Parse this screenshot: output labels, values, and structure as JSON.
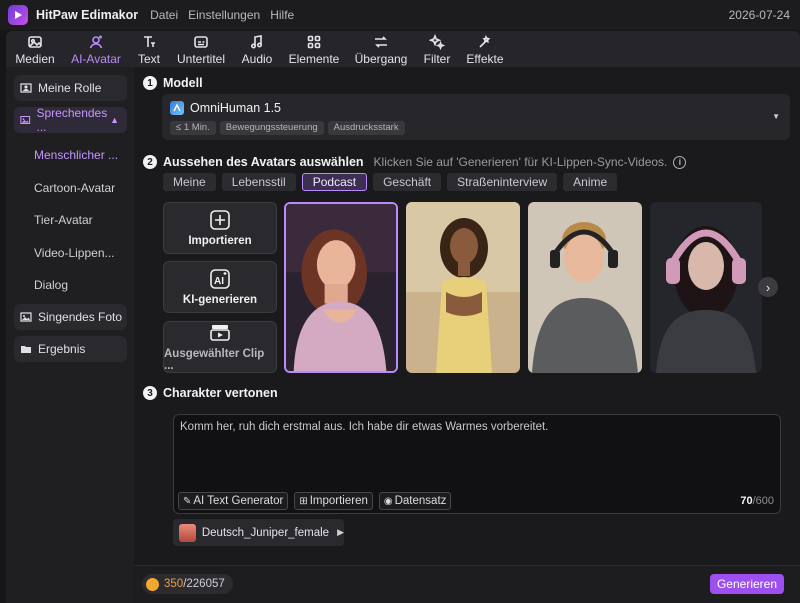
{
  "app": {
    "name": "HitPaw Edimakor",
    "menu": [
      "Datei",
      "Einstellungen",
      "Hilfe"
    ],
    "date": "2026-07-24",
    "accent": "#b98bff"
  },
  "toolbar": [
    {
      "label": "Medien",
      "icon": "media-icon",
      "active": false
    },
    {
      "label": "AI-Avatar",
      "icon": "avatar-icon",
      "active": true
    },
    {
      "label": "Text",
      "icon": "text-icon",
      "active": false
    },
    {
      "label": "Untertitel",
      "icon": "subtitle-icon",
      "active": false
    },
    {
      "label": "Audio",
      "icon": "audio-icon",
      "active": false
    },
    {
      "label": "Elemente",
      "icon": "elements-icon",
      "active": false
    },
    {
      "label": "Übergang",
      "icon": "transition-icon",
      "active": false
    },
    {
      "label": "Filter",
      "icon": "filter-icon",
      "active": false
    },
    {
      "label": "Effekte",
      "icon": "effects-icon",
      "active": false
    }
  ],
  "sidebar": {
    "my_role": "Meine Rolle",
    "speaking": "Sprechendes ...",
    "sub_items": [
      "Menschlicher ...",
      "Cartoon-Avatar",
      "Tier-Avatar",
      "Video-Lippen...",
      "Dialog"
    ],
    "singing": "Singendes Foto",
    "result": "Ergebnis"
  },
  "model": {
    "section_num": "1",
    "title": "Modell",
    "name": "OmniHuman 1.5",
    "tags": [
      "≤ 1 Min.",
      "Bewegungssteuerung",
      "Ausdrucksstark"
    ]
  },
  "appearance": {
    "section_num": "2",
    "title": "Aussehen des Avatars auswählen",
    "hint": "Klicken Sie auf 'Generieren' für KI-Lippen-Sync-Videos.",
    "categories": [
      "Meine",
      "Lebensstil",
      "Podcast",
      "Geschäft",
      "Straßeninterview",
      "Anime"
    ],
    "active_category": "Podcast",
    "import_label": "Importieren",
    "ai_generate_label": "KI-generieren",
    "selected_clip_label": "Ausgewählter Clip ..."
  },
  "voice": {
    "section_num": "3",
    "title": "Charakter vertonen",
    "text": "Komm her, ruh dich erstmal aus. Ich habe dir etwas Warmes vorbereitet.",
    "ai_text_gen": "AI Text Generator",
    "import": "Importieren",
    "dataset": "Datensatz",
    "count": "70",
    "max": "/600",
    "voice_name": "Deutsch_Juniper_female"
  },
  "footer": {
    "credits_used": "350",
    "credits_total": "/226057",
    "generate": "Generieren"
  }
}
